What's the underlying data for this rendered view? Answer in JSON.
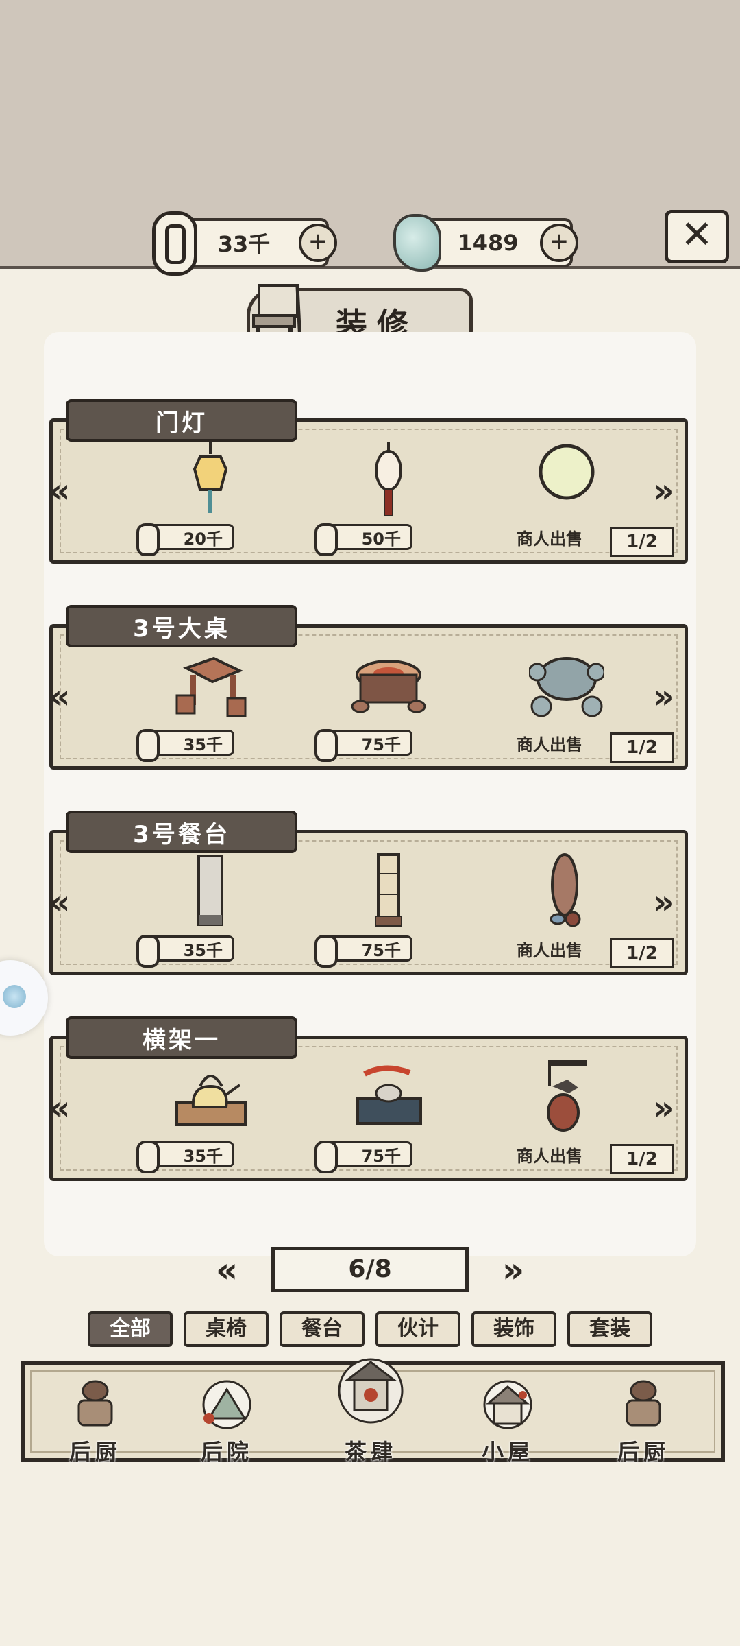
{
  "currency": {
    "coins": "33千",
    "jade": "1489",
    "plus_symbol": "+",
    "close_symbol": "✕"
  },
  "title": "装修",
  "items_rows": [
    {
      "label": "门灯",
      "prices": [
        "20千",
        "50千"
      ],
      "merchant": "商人出售",
      "page": "1/2"
    },
    {
      "label": "3号大桌",
      "prices": [
        "35千",
        "75千"
      ],
      "merchant": "商人出售",
      "page": "1/2"
    },
    {
      "label": "3号餐台",
      "prices": [
        "35千",
        "75千"
      ],
      "merchant": "商人出售",
      "page": "1/2"
    },
    {
      "label": "横架一",
      "prices": [
        "35千",
        "75千"
      ],
      "merchant": "商人出售",
      "page": "1/2"
    }
  ],
  "pager": "6/8",
  "tabs": [
    "全部",
    "桌椅",
    "餐台",
    "伙计",
    "装饰",
    "套装"
  ],
  "active_tab": "全部",
  "nav": [
    "后厨",
    "后院",
    "茶肆",
    "小屋",
    "后厨"
  ],
  "colors": {
    "background": "#f3efe4",
    "top_band": "#cfc6bb",
    "label_bg": "#5e554d",
    "card_bg": "#e6dfca"
  }
}
